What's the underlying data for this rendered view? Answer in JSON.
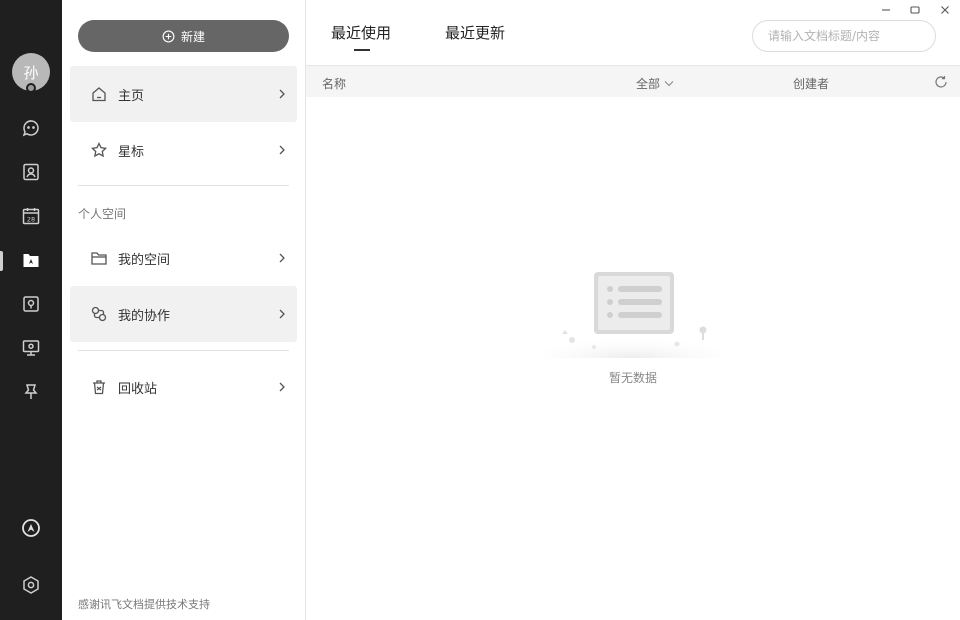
{
  "rail": {
    "avatar_text": "孙",
    "items": [
      "chat-icon",
      "contacts-icon",
      "calendar-icon",
      "docs-icon",
      "wiki-icon",
      "meeting-icon",
      "pin-icon",
      "app-logo-icon",
      "settings-icon"
    ],
    "calendar_day": "28"
  },
  "sidebar": {
    "new_button_label": "新建",
    "items": [
      {
        "label": "主页",
        "icon": "home-icon"
      },
      {
        "label": "星标",
        "icon": "star-icon"
      },
      {
        "label": "我的空间",
        "icon": "folder-icon"
      },
      {
        "label": "我的协作",
        "icon": "collab-icon"
      },
      {
        "label": "回收站",
        "icon": "trash-icon"
      }
    ],
    "section_label": "个人空间",
    "footer": "感谢讯飞文档提供技术支持"
  },
  "main": {
    "tabs": [
      {
        "label": "最近使用",
        "active": true
      },
      {
        "label": "最近更新",
        "active": false
      }
    ],
    "search": {
      "placeholder": "请输入文档标题/内容",
      "value": ""
    },
    "columns": {
      "name": "名称",
      "filter": "全部",
      "creator": "创建者"
    },
    "empty_text": "暂无数据"
  },
  "colors": {
    "rail_bg": "#1f1f1f",
    "new_button_bg": "#666666",
    "selected_item_bg": "#f1f1f1",
    "header_row_bg": "#f5f5f5"
  }
}
